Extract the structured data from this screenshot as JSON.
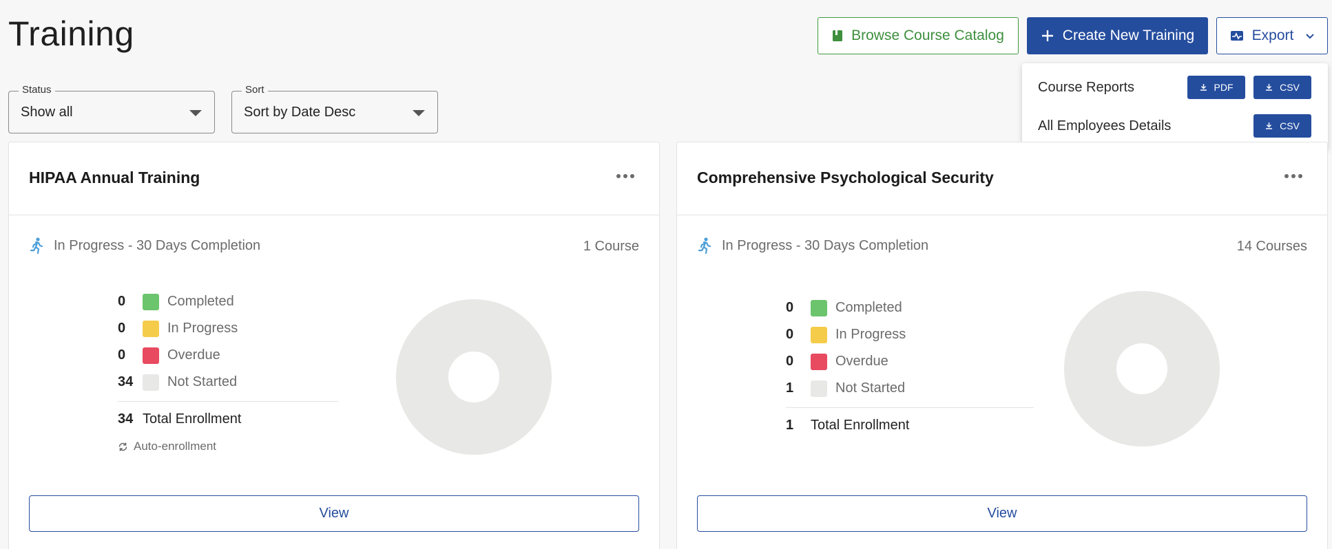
{
  "page": {
    "title": "Training"
  },
  "header": {
    "catalog_label": "Browse Course Catalog",
    "create_label": "Create New Training",
    "export_label": "Export"
  },
  "export_menu": {
    "course_reports_label": "Course Reports",
    "pdf_label": "PDF",
    "csv_label": "CSV",
    "employees_label": "All Employees Details",
    "employees_csv_label": "CSV"
  },
  "filters": {
    "status_legend": "Status",
    "status_value": "Show all",
    "sort_legend": "Sort",
    "sort_value": "Sort by Date Desc"
  },
  "colors": {
    "primary": "#254d9e",
    "catalog_green": "#3e8f3e",
    "completed": "#6cc46c",
    "in_progress": "#f5cb4a",
    "overdue": "#e84a5f",
    "not_started": "#e8e8e6",
    "donut": "#e8e8e6"
  },
  "cards": [
    {
      "title": "HIPAA Annual Training",
      "status": "In Progress - 30 Days Completion",
      "course_count": "1 Course",
      "completed": "0",
      "completed_label": "Completed",
      "in_progress": "0",
      "in_progress_label": "In Progress",
      "overdue": "0",
      "overdue_label": "Overdue",
      "not_started": "34",
      "not_started_label": "Not Started",
      "total": "34",
      "total_label": "Total Enrollment",
      "auto_label": "Auto-enrollment",
      "view_label": "View"
    },
    {
      "title": "Comprehensive Psychological Security",
      "status": "In Progress - 30 Days Completion",
      "course_count": "14 Courses",
      "completed": "0",
      "completed_label": "Completed",
      "in_progress": "0",
      "in_progress_label": "In Progress",
      "overdue": "0",
      "overdue_label": "Overdue",
      "not_started": "1",
      "not_started_label": "Not Started",
      "total": "1",
      "total_label": "Total Enrollment",
      "view_label": "View"
    }
  ]
}
